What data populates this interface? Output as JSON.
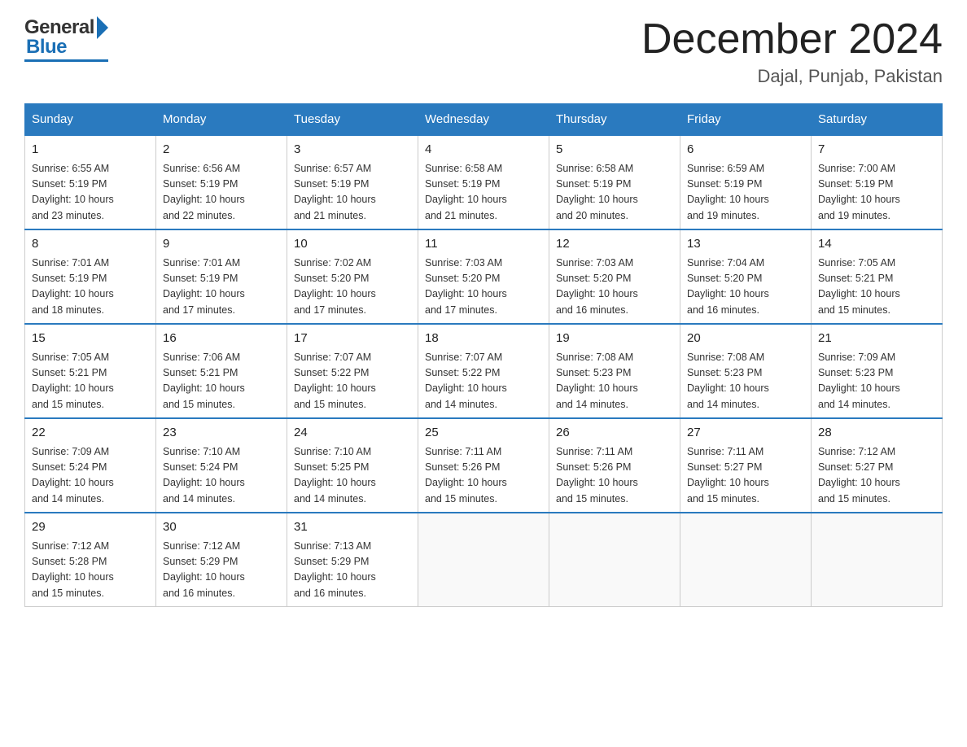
{
  "header": {
    "month_title": "December 2024",
    "location": "Dajal, Punjab, Pakistan",
    "logo_general": "General",
    "logo_blue": "Blue"
  },
  "days_of_week": [
    "Sunday",
    "Monday",
    "Tuesday",
    "Wednesday",
    "Thursday",
    "Friday",
    "Saturday"
  ],
  "weeks": [
    [
      {
        "day": "1",
        "sunrise": "6:55 AM",
        "sunset": "5:19 PM",
        "daylight": "10 hours and 23 minutes."
      },
      {
        "day": "2",
        "sunrise": "6:56 AM",
        "sunset": "5:19 PM",
        "daylight": "10 hours and 22 minutes."
      },
      {
        "day": "3",
        "sunrise": "6:57 AM",
        "sunset": "5:19 PM",
        "daylight": "10 hours and 21 minutes."
      },
      {
        "day": "4",
        "sunrise": "6:58 AM",
        "sunset": "5:19 PM",
        "daylight": "10 hours and 21 minutes."
      },
      {
        "day": "5",
        "sunrise": "6:58 AM",
        "sunset": "5:19 PM",
        "daylight": "10 hours and 20 minutes."
      },
      {
        "day": "6",
        "sunrise": "6:59 AM",
        "sunset": "5:19 PM",
        "daylight": "10 hours and 19 minutes."
      },
      {
        "day": "7",
        "sunrise": "7:00 AM",
        "sunset": "5:19 PM",
        "daylight": "10 hours and 19 minutes."
      }
    ],
    [
      {
        "day": "8",
        "sunrise": "7:01 AM",
        "sunset": "5:19 PM",
        "daylight": "10 hours and 18 minutes."
      },
      {
        "day": "9",
        "sunrise": "7:01 AM",
        "sunset": "5:19 PM",
        "daylight": "10 hours and 17 minutes."
      },
      {
        "day": "10",
        "sunrise": "7:02 AM",
        "sunset": "5:20 PM",
        "daylight": "10 hours and 17 minutes."
      },
      {
        "day": "11",
        "sunrise": "7:03 AM",
        "sunset": "5:20 PM",
        "daylight": "10 hours and 17 minutes."
      },
      {
        "day": "12",
        "sunrise": "7:03 AM",
        "sunset": "5:20 PM",
        "daylight": "10 hours and 16 minutes."
      },
      {
        "day": "13",
        "sunrise": "7:04 AM",
        "sunset": "5:20 PM",
        "daylight": "10 hours and 16 minutes."
      },
      {
        "day": "14",
        "sunrise": "7:05 AM",
        "sunset": "5:21 PM",
        "daylight": "10 hours and 15 minutes."
      }
    ],
    [
      {
        "day": "15",
        "sunrise": "7:05 AM",
        "sunset": "5:21 PM",
        "daylight": "10 hours and 15 minutes."
      },
      {
        "day": "16",
        "sunrise": "7:06 AM",
        "sunset": "5:21 PM",
        "daylight": "10 hours and 15 minutes."
      },
      {
        "day": "17",
        "sunrise": "7:07 AM",
        "sunset": "5:22 PM",
        "daylight": "10 hours and 15 minutes."
      },
      {
        "day": "18",
        "sunrise": "7:07 AM",
        "sunset": "5:22 PM",
        "daylight": "10 hours and 14 minutes."
      },
      {
        "day": "19",
        "sunrise": "7:08 AM",
        "sunset": "5:23 PM",
        "daylight": "10 hours and 14 minutes."
      },
      {
        "day": "20",
        "sunrise": "7:08 AM",
        "sunset": "5:23 PM",
        "daylight": "10 hours and 14 minutes."
      },
      {
        "day": "21",
        "sunrise": "7:09 AM",
        "sunset": "5:23 PM",
        "daylight": "10 hours and 14 minutes."
      }
    ],
    [
      {
        "day": "22",
        "sunrise": "7:09 AM",
        "sunset": "5:24 PM",
        "daylight": "10 hours and 14 minutes."
      },
      {
        "day": "23",
        "sunrise": "7:10 AM",
        "sunset": "5:24 PM",
        "daylight": "10 hours and 14 minutes."
      },
      {
        "day": "24",
        "sunrise": "7:10 AM",
        "sunset": "5:25 PM",
        "daylight": "10 hours and 14 minutes."
      },
      {
        "day": "25",
        "sunrise": "7:11 AM",
        "sunset": "5:26 PM",
        "daylight": "10 hours and 15 minutes."
      },
      {
        "day": "26",
        "sunrise": "7:11 AM",
        "sunset": "5:26 PM",
        "daylight": "10 hours and 15 minutes."
      },
      {
        "day": "27",
        "sunrise": "7:11 AM",
        "sunset": "5:27 PM",
        "daylight": "10 hours and 15 minutes."
      },
      {
        "day": "28",
        "sunrise": "7:12 AM",
        "sunset": "5:27 PM",
        "daylight": "10 hours and 15 minutes."
      }
    ],
    [
      {
        "day": "29",
        "sunrise": "7:12 AM",
        "sunset": "5:28 PM",
        "daylight": "10 hours and 15 minutes."
      },
      {
        "day": "30",
        "sunrise": "7:12 AM",
        "sunset": "5:29 PM",
        "daylight": "10 hours and 16 minutes."
      },
      {
        "day": "31",
        "sunrise": "7:13 AM",
        "sunset": "5:29 PM",
        "daylight": "10 hours and 16 minutes."
      },
      null,
      null,
      null,
      null
    ]
  ],
  "labels": {
    "sunrise": "Sunrise:",
    "sunset": "Sunset:",
    "daylight": "Daylight:"
  }
}
